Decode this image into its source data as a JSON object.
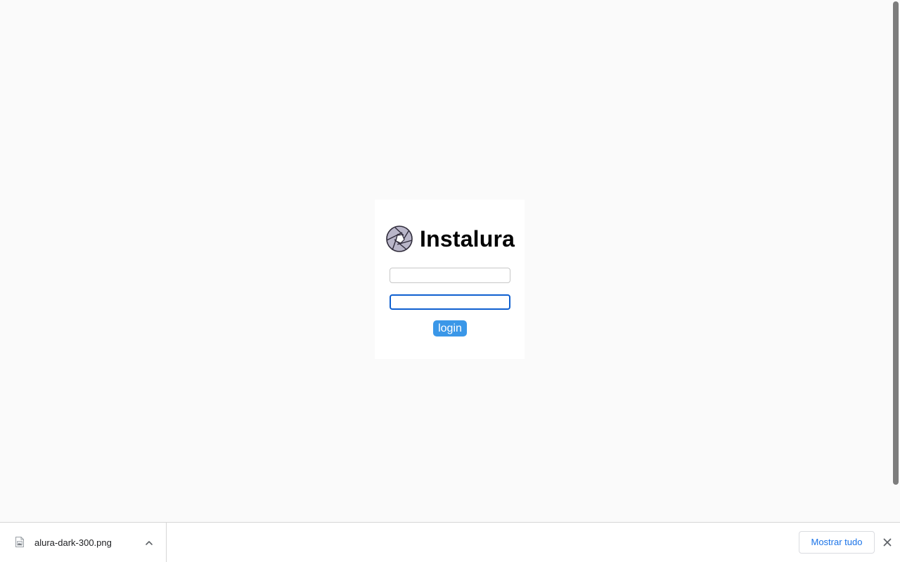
{
  "app": {
    "brand_name": "Instalura"
  },
  "login_form": {
    "username_value": "",
    "username_placeholder": "",
    "password_value": "",
    "password_placeholder": "",
    "submit_label": "login"
  },
  "download_shelf": {
    "file_name": "alura-dark-300.png",
    "show_all_label": "Mostrar tudo"
  },
  "icons": {
    "logo": "camera-aperture-icon",
    "file": "image-file-icon",
    "expand": "chevron-up-icon",
    "close": "close-icon"
  },
  "colors": {
    "page_background": "#fafafa",
    "card_background": "#ffffff",
    "button_background": "#3a97e8",
    "focus_ring": "#0e5fd0",
    "link_blue": "#1a73e8"
  }
}
